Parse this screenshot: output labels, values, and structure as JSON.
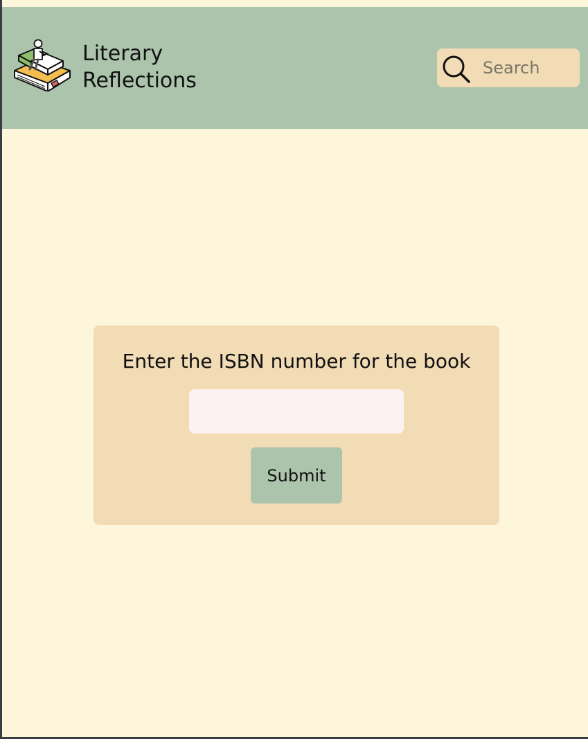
{
  "header": {
    "brand_line1": "Literary",
    "brand_line2": "Reflections",
    "logo_icon": "reader-on-books-icon",
    "search": {
      "placeholder": "Search",
      "icon": "search-icon"
    }
  },
  "main": {
    "prompt": "Enter the ISBN number for the book",
    "isbn_value": "",
    "submit_label": "Submit"
  },
  "colors": {
    "background": "#fdf6da",
    "header": "#abc4ab",
    "card": "#f2dcb6",
    "input": "#fcf2f1",
    "button": "#abc4ab"
  }
}
